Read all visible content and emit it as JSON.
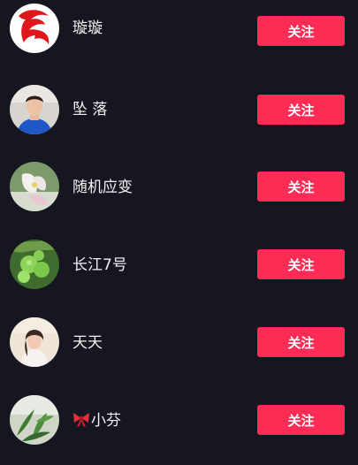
{
  "users": [
    {
      "name": "璇璇",
      "follow_label": "关注",
      "avatar_icon": "red-logo-avatar"
    },
    {
      "name": "坠 落",
      "follow_label": "关注",
      "avatar_icon": "man-portrait-avatar"
    },
    {
      "name": "随机应变",
      "follow_label": "关注",
      "avatar_icon": "flower-avatar"
    },
    {
      "name": "长江7号",
      "follow_label": "关注",
      "avatar_icon": "green-fruit-avatar"
    },
    {
      "name": "天天",
      "follow_label": "关注",
      "avatar_icon": "woman-portrait-avatar"
    },
    {
      "name": "小芬",
      "follow_label": "关注",
      "avatar_icon": "plant-avatar",
      "name_prefix_icon": "bow-emoji"
    }
  ],
  "colors": {
    "background": "#15161f",
    "follow_button": "#fe2c55",
    "name_text": "#f2f2f4"
  }
}
